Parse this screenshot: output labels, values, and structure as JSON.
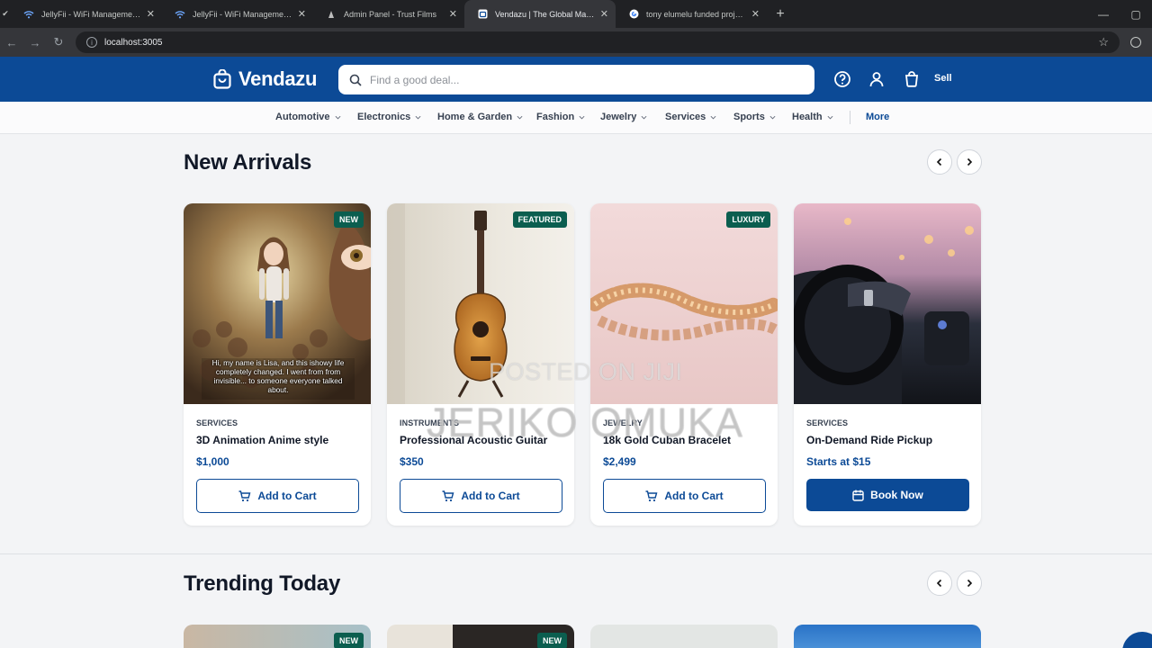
{
  "browser": {
    "tabs": [
      {
        "title": "JellyFii - WiFi Management Platform",
        "icon": "wifi-icon",
        "active": false
      },
      {
        "title": "JellyFii - WiFi Management Platform",
        "icon": "wifi-icon",
        "active": false
      },
      {
        "title": "Admin Panel - Trust Films",
        "icon": "film-icon",
        "active": false
      },
      {
        "title": "Vendazu | The Global Marketplace",
        "icon": "bag-icon",
        "active": true
      },
      {
        "title": "tony elumelu funded projects - Google Search",
        "icon": "google-icon",
        "active": false
      }
    ],
    "url": "localhost:3005"
  },
  "header": {
    "brand": "Vendazu",
    "search_placeholder": "Find a good deal...",
    "sell_label": "Sell",
    "icons": [
      "help-icon",
      "user-icon",
      "cart-icon"
    ],
    "bg_color": "#0c4a96"
  },
  "categories": [
    "Automotive",
    "Electronics",
    "Home & Garden",
    "Fashion",
    "Jewelry",
    "Services",
    "Sports",
    "Health"
  ],
  "more_label": "More",
  "new_arrivals": {
    "title": "New Arrivals",
    "cards": [
      {
        "badge": "NEW",
        "category": "SERVICES",
        "name": "3D Animation Anime style",
        "price": "$1,000",
        "button": "Add to Cart",
        "caption": "Hi, my name is Lisa, and this ishowy life completely changed. I went from from invisible... to someone everyone talked about."
      },
      {
        "badge": "FEATURED",
        "category": "INSTRUMENTS",
        "name": "Professional Acoustic Guitar",
        "price": "$350",
        "button": "Add to Cart"
      },
      {
        "badge": "LUXURY",
        "category": "JEWELRY",
        "name": "18k Gold Cuban Bracelet",
        "price": "$2,499",
        "button": "Add to Cart"
      },
      {
        "badge": "",
        "category": "SERVICES",
        "name": "On-Demand Ride Pickup",
        "price": "Starts at $15",
        "button": "Book Now"
      }
    ]
  },
  "trending": {
    "title": "Trending Today",
    "badges": [
      "NEW",
      "NEW"
    ]
  },
  "watermark": {
    "line1": "POSTED ON JIJI",
    "line2": "JERIKO OMUKA"
  }
}
